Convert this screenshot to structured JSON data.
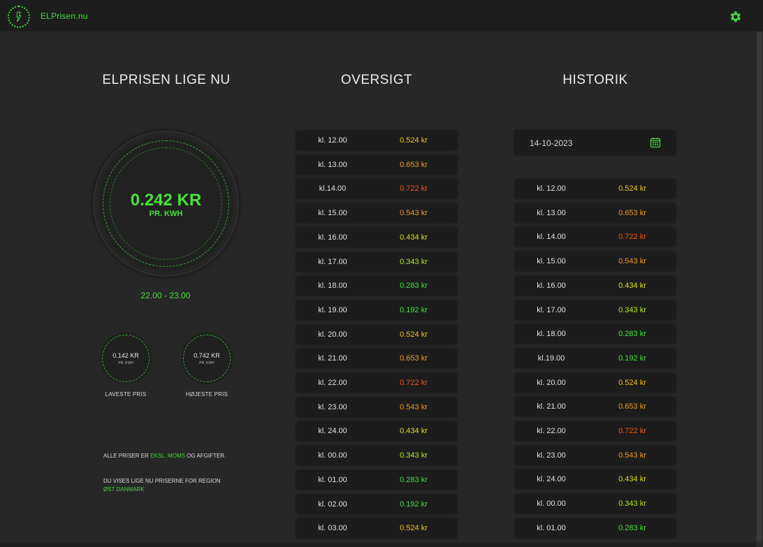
{
  "app": {
    "brand": "ELPrisen.nu",
    "logo_icon": "bolt-icon",
    "settings_icon": "gear-icon",
    "accent": "#46e03c"
  },
  "current": {
    "heading": "ELPRISEN LIGE NU",
    "price": "0.242 KR",
    "unit": "PR. KWH",
    "time_range": "22.00 - 23.00",
    "lowest": {
      "price": "0.142 KR",
      "unit": "PR. KWH",
      "label": "LAVESTE PRIS"
    },
    "highest": {
      "price": "0.742 KR",
      "unit": "PR. KWH",
      "label": "HØJESTE PRIS"
    },
    "note1_prefix": "ALLE PRISER ER",
    "note1_highlight": "EKSL. MOMS",
    "note1_suffix": "OG AFGIFTER.",
    "note2_prefix": "DU VISES LIGE NU PRISERNE FOR REGION",
    "note2_highlight": "ØST DANMARK"
  },
  "overview": {
    "heading": "OVERSIGT",
    "rows": [
      {
        "time": "kl. 12.00",
        "price": "0.524 kr",
        "color": "#f0c419"
      },
      {
        "time": "kl. 13.00",
        "price": "0.653 kr",
        "color": "#f39a1f"
      },
      {
        "time": "kl.14.00",
        "price": "0.722 kr",
        "color": "#f2541b"
      },
      {
        "time": "kl. 15.00",
        "price": "0.543 kr",
        "color": "#f39a1f"
      },
      {
        "time": "kl. 16.00",
        "price": "0.434 kr",
        "color": "#d9e021"
      },
      {
        "time": "kl. 17.00",
        "price": "0.343 kr",
        "color": "#b7ea23"
      },
      {
        "time": "kl. 18.00",
        "price": "0.283 kr",
        "color": "#3ee33a"
      },
      {
        "time": "kl. 19.00",
        "price": "0.192 kr",
        "color": "#3ee33a"
      },
      {
        "time": "kl. 20.00",
        "price": "0.524 kr",
        "color": "#f0c419"
      },
      {
        "time": "kl. 21.00",
        "price": "0.653 kr",
        "color": "#f39a1f"
      },
      {
        "time": "kl. 22.00",
        "price": "0.722 kr",
        "color": "#f2541b"
      },
      {
        "time": "kl. 23.00",
        "price": "0.543 kr",
        "color": "#f39a1f"
      },
      {
        "time": "kl. 24.00",
        "price": "0.434 kr",
        "color": "#d9e021"
      },
      {
        "time": "kl. 00.00",
        "price": "0.343 kr",
        "color": "#b7ea23"
      },
      {
        "time": "kl. 01.00",
        "price": "0.283 kr",
        "color": "#3ee33a"
      },
      {
        "time": "kl. 02.00",
        "price": "0.192 kr",
        "color": "#3ee33a"
      },
      {
        "time": "kl. 03.00",
        "price": "0.524 kr",
        "color": "#f0c419"
      }
    ]
  },
  "history": {
    "heading": "HISTORIK",
    "date": "14-10-2023",
    "calendar_icon": "calendar-icon",
    "rows": [
      {
        "time": "kl. 12.00",
        "price": "0.524 kr",
        "color": "#f0c419"
      },
      {
        "time": "kl. 13.00",
        "price": "0.653 kr",
        "color": "#f39a1f"
      },
      {
        "time": "kl. 14.00",
        "price": "0.722 kr",
        "color": "#f2541b"
      },
      {
        "time": "kl. 15.00",
        "price": "0.543 kr",
        "color": "#f39a1f"
      },
      {
        "time": "kl. 16.00",
        "price": "0.434 kr",
        "color": "#d9e021"
      },
      {
        "time": "kl. 17.00",
        "price": "0.343 kr",
        "color": "#b7ea23"
      },
      {
        "time": "kl. 18.00",
        "price": "0.283 kr",
        "color": "#3ee33a"
      },
      {
        "time": "kl.19.00",
        "price": "0.192 kr",
        "color": "#3ee33a"
      },
      {
        "time": "kl. 20.00",
        "price": "0.524 kr",
        "color": "#f0c419"
      },
      {
        "time": "kl. 21.00",
        "price": "0.653 kr",
        "color": "#f39a1f"
      },
      {
        "time": "kl. 22.00",
        "price": "0.722 kr",
        "color": "#f2541b"
      },
      {
        "time": "kl. 23.00",
        "price": "0.543 kr",
        "color": "#f39a1f"
      },
      {
        "time": "kl. 24.00",
        "price": "0.434 kr",
        "color": "#d9e021"
      },
      {
        "time": "kl. 00.00",
        "price": "0.343 kr",
        "color": "#b7ea23"
      },
      {
        "time": "kl. 01.00",
        "price": "0.283 kr",
        "color": "#3ee33a"
      }
    ]
  }
}
